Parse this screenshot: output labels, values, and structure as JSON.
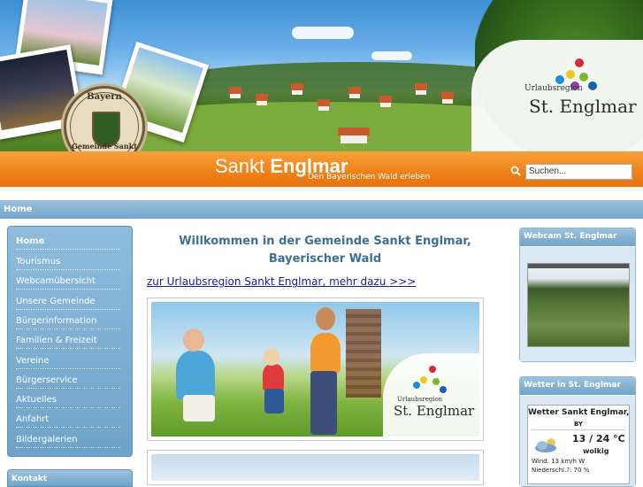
{
  "header": {
    "brand_light": "Sankt ",
    "brand_bold": "Englmar",
    "tagline": "Den Bayerischen Wald erleben",
    "logo_subtitle": "Urlaubsregion",
    "logo_name": "St. Englmar",
    "seal_top": "Bayern",
    "seal_bottom": "Gemeinde Sankt Englmar",
    "search_placeholder": "Suchen...",
    "accent_color": "#f08018"
  },
  "breadcrumb": {
    "label": "Home"
  },
  "sidebar": {
    "items": [
      {
        "label": "Home"
      },
      {
        "label": "Tourismus"
      },
      {
        "label": "Webcamübersicht"
      },
      {
        "label": "Unsere Gemeinde"
      },
      {
        "label": "Bürgerinformation"
      },
      {
        "label": "Familien & Freizeit"
      },
      {
        "label": "Vereine"
      },
      {
        "label": "Bürgerservice"
      },
      {
        "label": "Aktuelles"
      },
      {
        "label": "Anfahrt"
      },
      {
        "label": "Bildergalerien"
      }
    ],
    "kontakt_label": "Kontakt"
  },
  "main": {
    "welcome_line1": "Willkommen in der Gemeinde Sankt Englmar,",
    "welcome_line2": "Bayerischer Wald",
    "region_link": "zur Urlaubsregion Sankt Englmar, mehr dazu >>>",
    "image_logo_subtitle": "Urlaubsregion",
    "image_logo_name": "St. Englmar"
  },
  "webcam": {
    "title": "Webcam St. Englmar"
  },
  "weather": {
    "panel_title": "Wetter in St. Englmar",
    "heading": "Wetter Sankt Englmar,",
    "region": "BY",
    "temps": "13 / 24 °C",
    "condition": "wolkig",
    "wind": "Wind: 13 km/h W",
    "precip": "Niederschl.?: 70 %"
  }
}
